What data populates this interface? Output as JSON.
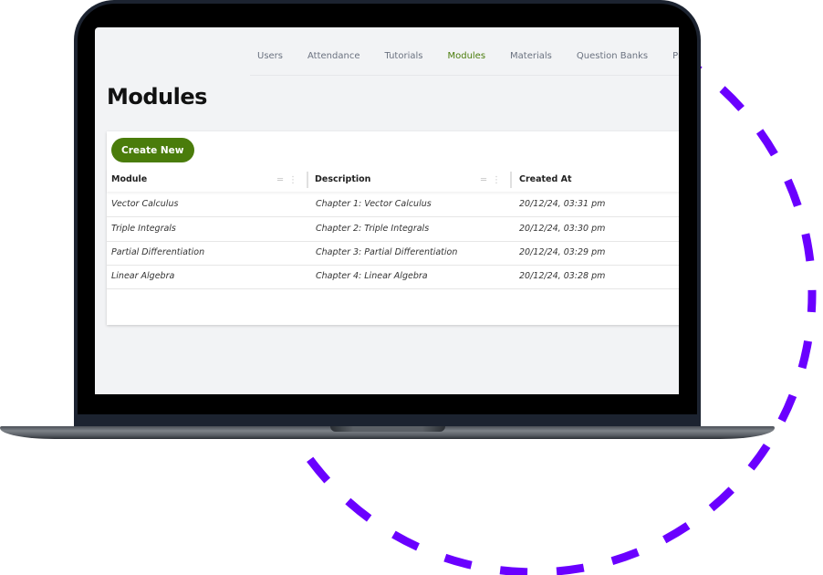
{
  "nav": {
    "items": [
      {
        "label": "Users",
        "active": false
      },
      {
        "label": "Attendance",
        "active": false
      },
      {
        "label": "Tutorials",
        "active": false
      },
      {
        "label": "Modules",
        "active": true
      },
      {
        "label": "Materials",
        "active": false
      },
      {
        "label": "Question Banks",
        "active": false
      },
      {
        "label": "Practice P",
        "active": false
      }
    ]
  },
  "page": {
    "title": "Modules",
    "create_button": "Create New"
  },
  "table": {
    "columns": [
      "Module",
      "Description",
      "Created At"
    ],
    "rows": [
      {
        "module": "Vector Calculus",
        "description": "Chapter 1: Vector Calculus",
        "created_at": "20/12/24, 03:31 pm"
      },
      {
        "module": "Triple Integrals",
        "description": "Chapter 2: Triple Integrals",
        "created_at": "20/12/24, 03:30 pm"
      },
      {
        "module": "Partial Differentiation",
        "description": "Chapter 3: Partial Differentiation",
        "created_at": "20/12/24, 03:29 pm"
      },
      {
        "module": "Linear Algebra",
        "description": "Chapter 4: Linear Algebra",
        "created_at": "20/12/24, 03:28 pm"
      }
    ]
  },
  "theme": {
    "accent": "#4a7c0b",
    "ring": "#6a00ff",
    "screen_bg": "#f2f3f5"
  }
}
